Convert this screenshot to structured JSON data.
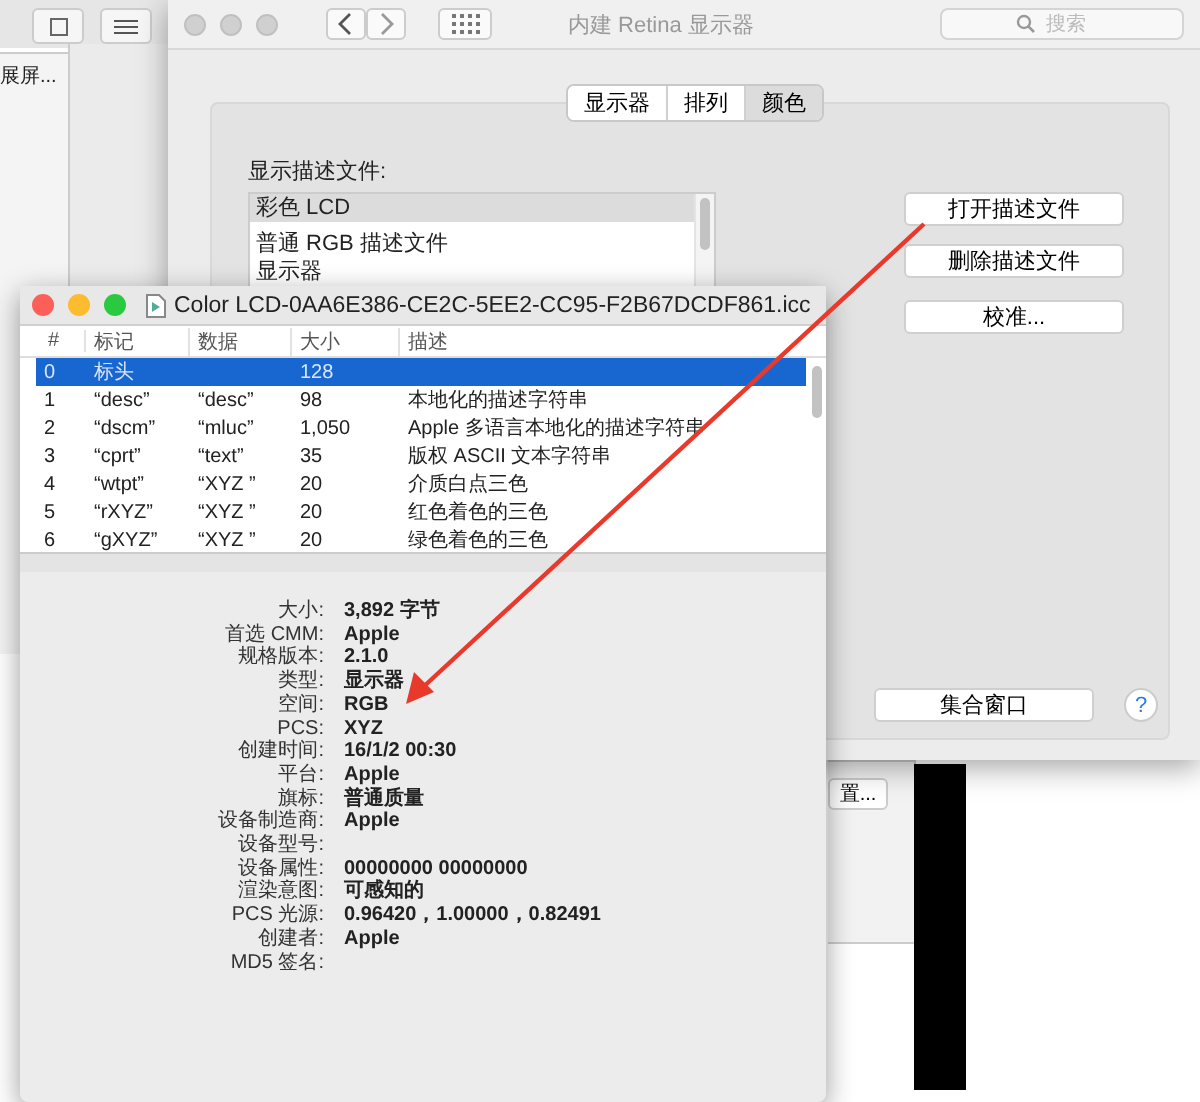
{
  "background": {
    "tab_label": "展屏...",
    "button": "置..."
  },
  "prefs_window": {
    "title": "内建 Retina 显示器",
    "search_placeholder": "搜索",
    "tabs": [
      {
        "label": "显示器",
        "selected": false
      },
      {
        "label": "排列",
        "selected": false
      },
      {
        "label": "颜色",
        "selected": true
      }
    ],
    "profile_label": "显示描述文件:",
    "profiles": [
      {
        "name": "彩色 LCD",
        "selected": true
      },
      {
        "name": "普通 RGB 描述文件",
        "selected": false
      },
      {
        "name": "显示器",
        "selected": false
      }
    ],
    "buttons": [
      "打开描述文件",
      "删除描述文件",
      "校准..."
    ],
    "gather_button": "集合窗口",
    "help": "?"
  },
  "icc_window": {
    "title": "Color LCD-0AA6E386-CE2C-5EE2-CC95-F2B67DCDF861.icc",
    "columns": [
      "#",
      "标记",
      "数据",
      "大小",
      "描述"
    ],
    "rows": [
      {
        "cells": [
          "0",
          "标头",
          "",
          "128",
          ""
        ],
        "selected": true
      },
      {
        "cells": [
          "1",
          "“desc”",
          "“desc”",
          "98",
          "本地化的描述字符串"
        ],
        "selected": false
      },
      {
        "cells": [
          "2",
          "“dscm”",
          "“mluc”",
          "1,050",
          "Apple 多语言本地化的描述字符串"
        ],
        "selected": false
      },
      {
        "cells": [
          "3",
          "“cprt”",
          "“text”",
          "35",
          "版权 ASCII 文本字符串"
        ],
        "selected": false
      },
      {
        "cells": [
          "4",
          "“wtpt”",
          "“XYZ ”",
          "20",
          "介质白点三色"
        ],
        "selected": false
      },
      {
        "cells": [
          "5",
          "“rXYZ”",
          "“XYZ ”",
          "20",
          "红色着色的三色"
        ],
        "selected": false
      },
      {
        "cells": [
          "6",
          "“gXYZ”",
          "“XYZ ”",
          "20",
          "绿色着色的三色"
        ],
        "selected": false
      }
    ],
    "details": [
      {
        "label": "大小:",
        "value": "3,892 字节"
      },
      {
        "label": "首选 CMM:",
        "value": "Apple"
      },
      {
        "label": "规格版本:",
        "value": "2.1.0"
      },
      {
        "label": "类型:",
        "value": "显示器"
      },
      {
        "label": "空间:",
        "value": "RGB"
      },
      {
        "label": "PCS:",
        "value": "XYZ"
      },
      {
        "label": "创建时间:",
        "value": "16/1/2 00:30"
      },
      {
        "label": "平台:",
        "value": "Apple"
      },
      {
        "label": "旗标:",
        "value": "普通质量"
      },
      {
        "label": "设备制造商:",
        "value": "Apple"
      },
      {
        "label": "设备型号:"
      },
      {
        "label": "设备属性:",
        "value": "00000000 00000000"
      },
      {
        "label": "渲染意图:",
        "value": "可感知的"
      },
      {
        "label": "PCS 光源:",
        "value": "0.96420，1.00000，0.82491"
      },
      {
        "label": "创建者:",
        "value": "Apple"
      },
      {
        "label": "MD5 签名:"
      }
    ]
  }
}
